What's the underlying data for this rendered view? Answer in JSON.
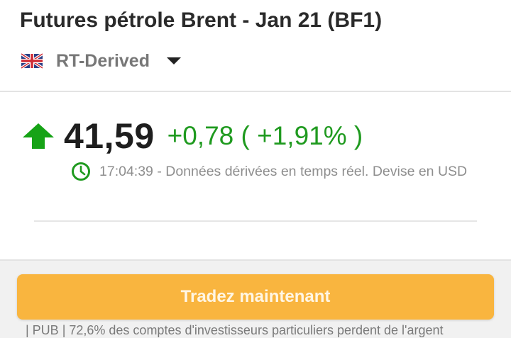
{
  "header": {
    "title": "Futures pétrole Brent - Jan 21 (BF1)",
    "flag_icon": "uk-flag-icon",
    "source": "RT-Derived",
    "dropdown_icon": "caret-down-icon"
  },
  "quote": {
    "trend_icon": "arrow-up-icon",
    "price": "41,59",
    "change": "+0,78 ( +1,91% )",
    "time": "17:04:39",
    "description": "- Données dérivées en temps réel. Devise en USD",
    "colors": {
      "positive": "#1f9a1f",
      "arrow": "#16a316"
    }
  },
  "cta": {
    "label": "Tradez maintenant",
    "color": "#f9b53f"
  },
  "disclaimer": "| PUB | 72,6% des comptes d'investisseurs particuliers perdent de l'argent"
}
